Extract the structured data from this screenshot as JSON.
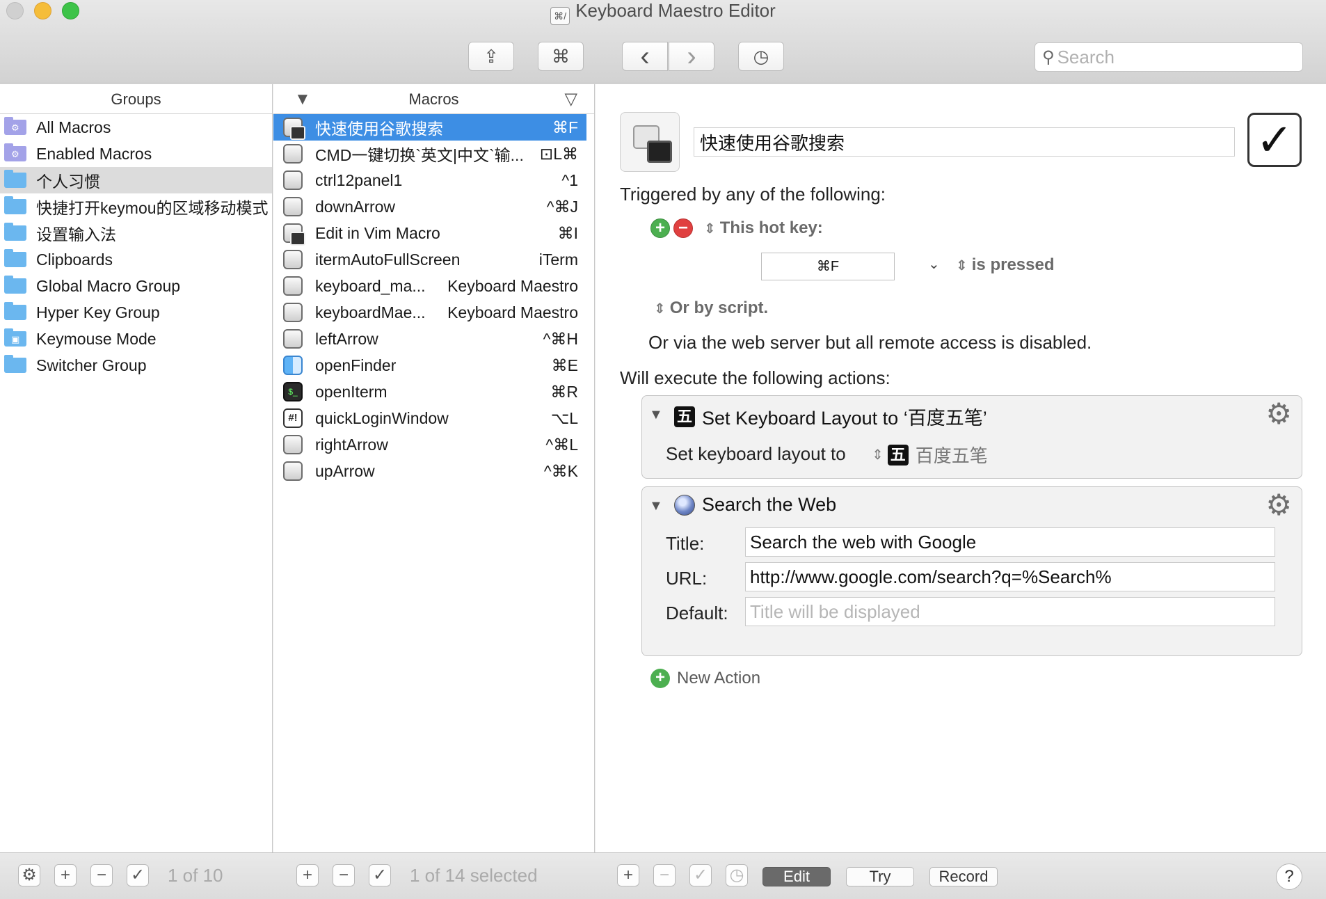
{
  "window": {
    "title": "Keyboard Maestro Editor",
    "app_icon_glyph": "⌘/"
  },
  "toolbar": {
    "share_icon": "⇪",
    "cmd_icon": "⌘",
    "back_icon": "‹",
    "forward_icon": "›",
    "clock_icon": "◷",
    "search_icon": "⚲",
    "search_placeholder": "Search"
  },
  "groups": {
    "header": "Groups",
    "items": [
      {
        "label": "All Macros",
        "color": "purple",
        "badge": "⚙"
      },
      {
        "label": "Enabled Macros",
        "color": "purple",
        "badge": "⚙"
      },
      {
        "label": "个人习惯",
        "color": "blue",
        "badge": ""
      },
      {
        "label": "快捷打开keymou的区域移动模式",
        "color": "blue",
        "badge": ""
      },
      {
        "label": "设置输入法",
        "color": "blue",
        "badge": ""
      },
      {
        "label": "Clipboards",
        "color": "blue",
        "badge": ""
      },
      {
        "label": "Global Macro Group",
        "color": "blue",
        "badge": ""
      },
      {
        "label": "Hyper Key Group",
        "color": "blue",
        "badge": ""
      },
      {
        "label": "Keymouse Mode",
        "color": "blue",
        "badge": "▣"
      },
      {
        "label": "Switcher Group",
        "color": "blue",
        "badge": ""
      }
    ],
    "selected_index": 2
  },
  "macros": {
    "header": "Macros",
    "items": [
      {
        "name": "快速使用谷歌搜索",
        "trigger": "⌘F",
        "icon": "stack"
      },
      {
        "name": "CMD一键切换`英文|中文`输...",
        "trigger": "⊡L⌘",
        "icon": "key"
      },
      {
        "name": "ctrl12panel1",
        "trigger": "^1",
        "icon": "key"
      },
      {
        "name": "downArrow",
        "trigger": "^⌘J",
        "icon": "key"
      },
      {
        "name": "Edit in Vim Macro",
        "trigger": "⌘I",
        "icon": "stack"
      },
      {
        "name": "itermAutoFullScreen",
        "trigger": "iTerm",
        "icon": "key"
      },
      {
        "name": "keyboard_ma...",
        "trigger": "Keyboard Maestro",
        "icon": "key"
      },
      {
        "name": "keyboardMae...",
        "trigger": "Keyboard Maestro",
        "icon": "key"
      },
      {
        "name": "leftArrow",
        "trigger": "^⌘H",
        "icon": "key"
      },
      {
        "name": "openFinder",
        "trigger": "⌘E",
        "icon": "finder"
      },
      {
        "name": "openIterm",
        "trigger": "⌘R",
        "icon": "term"
      },
      {
        "name": "quickLoginWindow",
        "trigger": "⌥L",
        "icon": "hash"
      },
      {
        "name": "rightArrow",
        "trigger": "^⌘L",
        "icon": "key"
      },
      {
        "name": "upArrow",
        "trigger": "^⌘K",
        "icon": "key"
      }
    ],
    "selected_index": 0
  },
  "editor": {
    "macro_name": "快速使用谷歌搜索",
    "enabled_check": "✓",
    "triggered_by": "Triggered by any of the following:",
    "trigger_type": "This hot key:",
    "hotkey": "⌘F",
    "is_pressed": "is pressed",
    "or_by_script": "Or by script.",
    "web_server_note": "Or via the web server but all remote access is disabled.",
    "will_execute": "Will execute the following actions:",
    "new_action": "New Action",
    "actions": [
      {
        "title": "Set Keyboard Layout to ‘百度五笔’",
        "icon_glyph": "五",
        "field_label": "Set keyboard layout to",
        "layout_value": "百度五笔"
      },
      {
        "title": "Search the Web",
        "fields": [
          {
            "label": "Title:",
            "value": "Search the web with Google",
            "placeholder": ""
          },
          {
            "label": "URL:",
            "value": "http://www.google.com/search?q=%Search%",
            "placeholder": ""
          },
          {
            "label": "Default:",
            "value": "",
            "placeholder": "Title will be displayed"
          }
        ]
      }
    ]
  },
  "bottombar": {
    "groups_count": "1 of 10",
    "macros_count": "1 of 14 selected",
    "edit_label": "Edit",
    "try_label": "Try",
    "record_label": "Record",
    "help_label": "?"
  }
}
